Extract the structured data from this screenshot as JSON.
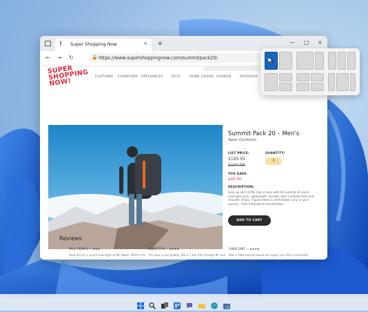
{
  "browser": {
    "tab_title": "Super Shopping Now",
    "tab_favicon": "!",
    "tab_close": "×",
    "new_tab": "+",
    "url": "https://www.supershoppingnow.com/summitpack20/",
    "window_controls": [
      "—",
      "□",
      "×"
    ]
  },
  "site": {
    "logo_lines": [
      "SUPER",
      "SHOPPING",
      "NOW!"
    ],
    "menu": [
      "CLOTHING",
      "FURNITURE",
      "APPLIANCES",
      "TECH",
      "HOME GOODS",
      "GARDEN",
      "OUTDOOR"
    ]
  },
  "product": {
    "title": "Summit Pack 20 – Men's",
    "brand": "Apex Outdoors",
    "list_price_label": "LIST PRICE:",
    "price": "$189.99",
    "old_price": "$194.99",
    "quantity_label": "QUANTITY:",
    "quantity": "1",
    "you_save_label": "YOU SAVE:",
    "you_save": "$25.00",
    "description_label": "DESCRIPTION:",
    "description": "Gear up and hit the trail in style with the Summit 20 men's overnight pack. Lightweight, durable, with a padded back and shoulder straps, it guarantees a comfortable carry on your journey - from trailhead to mountaintop.",
    "add_to_cart": "ADD TO CART"
  },
  "reviews": {
    "heading": "Reviews",
    "items": [
      {
        "author": "PAUL FROM IL — ★★★",
        "text": "Took this on a recent overnight at Mt. Baker. While it fit"
      },
      {
        "author": "ROBERTO M — ★★★★",
        "text": "The pack is top quality. Did a 7 day trek through BC and"
      },
      {
        "author": "CHRIS 1987 — ★★★★",
        "text": "Was a little worried about the zipper per other comments,"
      }
    ]
  },
  "taskbar": {
    "icons": [
      "windows-start-icon",
      "search-icon",
      "task-view-icon",
      "widgets-icon",
      "chat-icon",
      "file-explorer-icon",
      "edge-icon",
      "store-icon"
    ]
  },
  "colors": {
    "accent_red": "#e0283d",
    "snap_highlight": "#1565c0",
    "cart_button": "#2b2b2b"
  }
}
